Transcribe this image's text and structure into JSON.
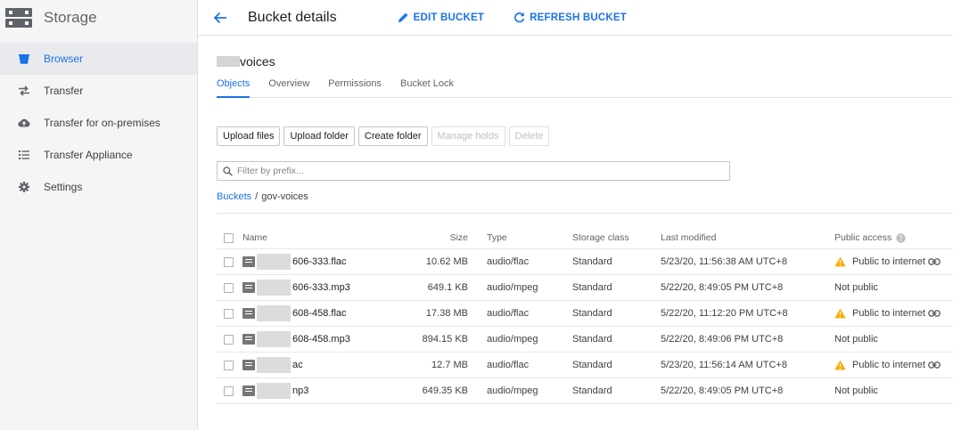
{
  "app": {
    "title": "Storage"
  },
  "sidebar": {
    "items": [
      {
        "label": "Browser",
        "icon": "bucket-icon"
      },
      {
        "label": "Transfer",
        "icon": "transfer-icon"
      },
      {
        "label": "Transfer for on-premises",
        "icon": "cloud-upload-icon"
      },
      {
        "label": "Transfer Appliance",
        "icon": "list-icon"
      },
      {
        "label": "Settings",
        "icon": "gear-icon"
      }
    ]
  },
  "header": {
    "title": "Bucket details",
    "edit_label": "EDIT BUCKET",
    "refresh_label": "REFRESH BUCKET"
  },
  "bucket": {
    "name_suffix": "voices"
  },
  "tabs": [
    {
      "label": "Objects"
    },
    {
      "label": "Overview"
    },
    {
      "label": "Permissions"
    },
    {
      "label": "Bucket Lock"
    }
  ],
  "actions": {
    "upload_files": "Upload files",
    "upload_folder": "Upload folder",
    "create_folder": "Create folder",
    "manage_holds": "Manage holds",
    "delete": "Delete"
  },
  "filter": {
    "placeholder": "Filter by prefix..."
  },
  "breadcrumb": {
    "root": "Buckets",
    "separator": "/",
    "current": "gov-voices"
  },
  "table": {
    "headers": {
      "name": "Name",
      "size": "Size",
      "type": "Type",
      "storage_class": "Storage class",
      "last_modified": "Last modified",
      "public_access": "Public access"
    },
    "rows": [
      {
        "name": "606-333.flac",
        "size": "10.62 MB",
        "type": "audio/flac",
        "storage_class": "Standard",
        "last_modified": "5/23/20, 11:56:38 AM UTC+8",
        "public_access": "Public to internet"
      },
      {
        "name": "606-333.mp3",
        "size": "649.1 KB",
        "type": "audio/mpeg",
        "storage_class": "Standard",
        "last_modified": "5/22/20, 8:49:05 PM UTC+8",
        "public_access": "Not public"
      },
      {
        "name": "608-458.flac",
        "size": "17.38 MB",
        "type": "audio/flac",
        "storage_class": "Standard",
        "last_modified": "5/22/20, 11:12:20 PM UTC+8",
        "public_access": "Public to internet"
      },
      {
        "name": "608-458.mp3",
        "size": "894.15 KB",
        "type": "audio/mpeg",
        "storage_class": "Standard",
        "last_modified": "5/22/20, 8:49:06 PM UTC+8",
        "public_access": "Not public"
      },
      {
        "name": "ac",
        "size": "12.7 MB",
        "type": "audio/flac",
        "storage_class": "Standard",
        "last_modified": "5/23/20, 11:56:14 AM UTC+8",
        "public_access": "Public to internet"
      },
      {
        "name": "np3",
        "size": "649.35 KB",
        "type": "audio/mpeg",
        "storage_class": "Standard",
        "last_modified": "5/22/20, 8:49:05 PM UTC+8",
        "public_access": "Not public"
      }
    ]
  },
  "colors": {
    "accent": "#1a73e8",
    "warning": "#f9ab00",
    "sidebar_bg": "#f5f5f5"
  }
}
